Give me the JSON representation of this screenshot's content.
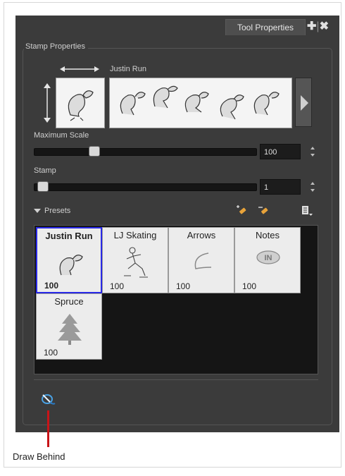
{
  "window": {
    "tab_title": "Tool Properties",
    "tab_icons": [
      "plus-icon",
      "close-icon"
    ]
  },
  "stamp_properties": {
    "group_title": "Stamp Properties",
    "stamp_name": "Justin Run",
    "strip_frame_count": 5,
    "max_scale": {
      "label": "Maximum Scale",
      "value": "100",
      "slider_fraction": 0.26
    },
    "stamp": {
      "label": "Stamp",
      "value": "1",
      "slider_fraction": 0.0
    }
  },
  "presets": {
    "label": "Presets",
    "items": [
      {
        "name": "Justin Run",
        "value": "100",
        "selected": true,
        "icon": "squirrel-icon"
      },
      {
        "name": "LJ Skating",
        "value": "100",
        "selected": false,
        "icon": "skater-icon"
      },
      {
        "name": "Arrows",
        "value": "100",
        "selected": false,
        "icon": "arrow-stroke-icon"
      },
      {
        "name": "Notes",
        "value": "100",
        "selected": false,
        "icon": "notes-icon"
      },
      {
        "name": "Spruce",
        "value": "100",
        "selected": false,
        "icon": "spruce-tree-icon"
      }
    ]
  },
  "callout": {
    "label": "Draw Behind"
  },
  "colors": {
    "panel": "#3b3b3b",
    "selection_border": "#2929e6",
    "callout": "#c81418"
  }
}
